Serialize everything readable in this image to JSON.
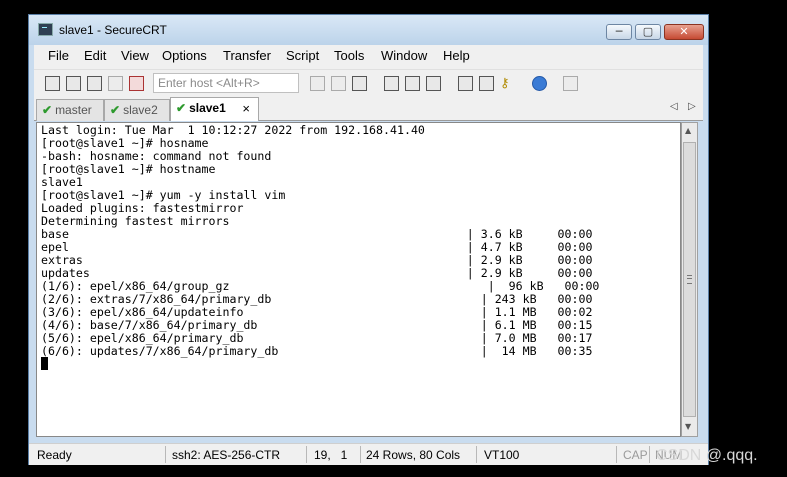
{
  "window": {
    "title": "slave1 - SecureCRT",
    "controls": [
      "─",
      "▢",
      "✕"
    ]
  },
  "menu": [
    "File",
    "Edit",
    "View",
    "Options",
    "Transfer",
    "Script",
    "Tools",
    "Window",
    "Help"
  ],
  "toolbar": {
    "host_placeholder": "Enter host <Alt+R>"
  },
  "tabs": [
    {
      "label": "master",
      "active": false
    },
    {
      "label": "slave2",
      "active": false
    },
    {
      "label": "slave1",
      "active": true
    }
  ],
  "tab_close": "×",
  "tab_nav": [
    "◁",
    "▷"
  ],
  "terminal": {
    "lines": [
      "Last login: Tue Mar  1 10:12:27 2022 from 192.168.41.40",
      "[root@slave1 ~]# hosname",
      "-bash: hosname: command not found",
      "[root@slave1 ~]# hostname",
      "slave1",
      "[root@slave1 ~]# yum -y install vim",
      "Loaded plugins: fastestmirror",
      "Determining fastest mirrors",
      "base                                                         | 3.6 kB     00:00",
      "epel                                                         | 4.7 kB     00:00",
      "extras                                                       | 2.9 kB     00:00",
      "updates                                                      | 2.9 kB     00:00",
      "(1/6): epel/x86_64/group_gz                                     |  96 kB   00:00",
      "(2/6): extras/7/x86_64/primary_db                              | 243 kB   00:00",
      "(3/6): epel/x86_64/updateinfo                                  | 1.1 MB   00:02",
      "(4/6): base/7/x86_64/primary_db                                | 6.1 MB   00:15",
      "(5/6): epel/x86_64/primary_db                                  | 7.0 MB   00:17",
      "(6/6): updates/7/x86_64/primary_db                             |  14 MB   00:35"
    ]
  },
  "scrollbar": {
    "up": "▲",
    "down": "▼"
  },
  "status": {
    "state": "Ready",
    "cipher": "ssh2: AES-256-CTR",
    "cursor_pos": "19,   1",
    "size": "24 Rows, 80 Cols",
    "emulation": "VT100",
    "caps": "CAP",
    "num": "NUM"
  },
  "watermark": "CSDN @.qqq."
}
